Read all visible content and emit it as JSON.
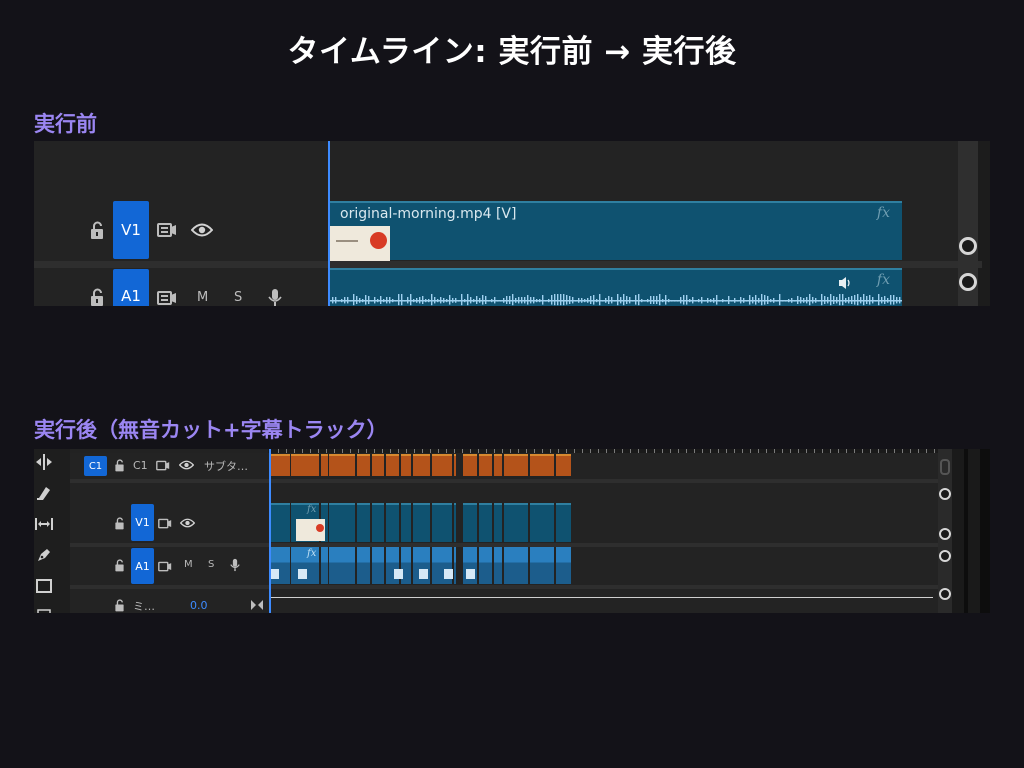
{
  "page_title": "タイムライン: 実行前 → 実行後",
  "before": {
    "label": "実行前",
    "video_track": {
      "target": "V1"
    },
    "audio_track": {
      "target": "A1",
      "mute": "M",
      "solo": "S"
    },
    "video_clip": {
      "name": "original-morning.mp4 [V]",
      "fx": "fx"
    },
    "audio_clip": {
      "fx": "fx"
    }
  },
  "after": {
    "label": "実行後（無音カット+字幕トラック）",
    "caption_track": {
      "target": "C1",
      "name": "C1",
      "title": "サブタ…"
    },
    "video_track": {
      "target": "V1",
      "fx": "fx"
    },
    "audio_track": {
      "target": "A1",
      "mute": "M",
      "solo": "S",
      "fx": "fx"
    },
    "mix_track": {
      "name": "ミ…",
      "value": "0.0"
    }
  },
  "colors": {
    "accent_label": "#9b86f2",
    "track_target": "#1267d6",
    "clip_video": "#0f5270",
    "clip_audio_after": "#2a7fbf",
    "subtitle_clip": "#b4531a",
    "playhead": "#3d8bff"
  }
}
